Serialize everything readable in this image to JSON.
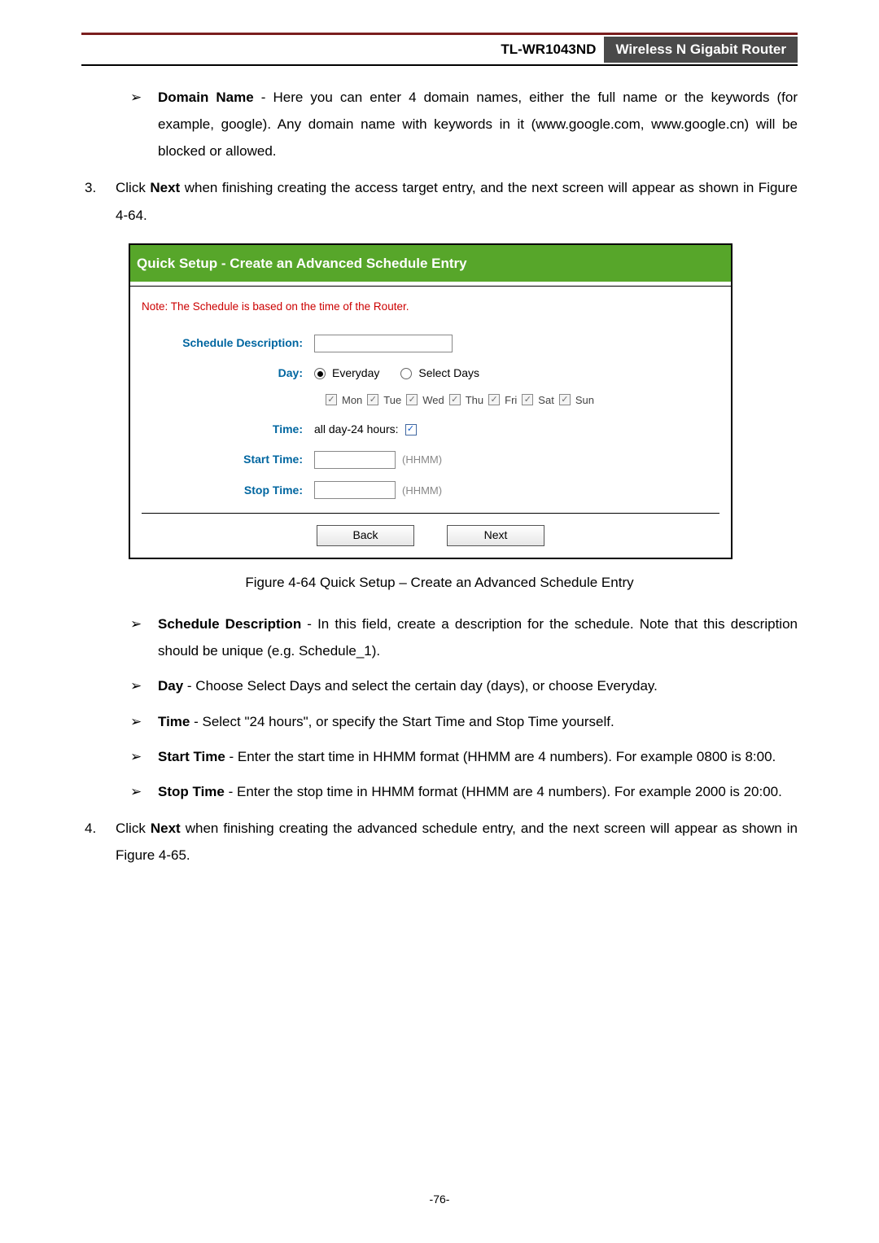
{
  "header": {
    "model": "TL-WR1043ND",
    "product": "Wireless N Gigabit Router"
  },
  "bullets": {
    "domain_name": {
      "label": "Domain Name",
      "text": " - Here you can enter 4 domain names, either the full name or the keywords (for example, google). Any domain name with keywords in it (www.google.com, www.google.cn) will be blocked or allowed."
    },
    "schedule_desc": {
      "label": "Schedule Description",
      "text": " - In this field, create a description for the schedule. Note that this description should be unique (e.g. Schedule_1)."
    },
    "day": {
      "label": "Day",
      "text": " - Choose Select Days and select the certain day (days), or choose Everyday."
    },
    "time": {
      "label": "Time",
      "text": " - Select \"24 hours\", or specify the Start Time and Stop Time yourself."
    },
    "start_time": {
      "label": "Start Time",
      "text": " - Enter the start time in HHMM format (HHMM are 4 numbers). For example 0800 is 8:00."
    },
    "stop_time": {
      "label": "Stop Time",
      "text": " - Enter the stop time in HHMM format (HHMM are 4 numbers). For example 2000 is 20:00."
    }
  },
  "steps": {
    "s3": {
      "num": "3.",
      "pre": "Click ",
      "bold": "Next",
      "post": " when finishing creating the access target entry, and the next screen will appear as shown in Figure 4-64."
    },
    "s4": {
      "num": "4.",
      "pre": "Click ",
      "bold": "Next",
      "post": " when finishing creating the advanced schedule entry, and the next screen will appear as shown in Figure 4-65."
    }
  },
  "figure": {
    "title": "Quick Setup - Create an Advanced Schedule Entry",
    "note": "Note: The Schedule is based on the time of the Router.",
    "labels": {
      "desc": "Schedule Description:",
      "day": "Day:",
      "time": "Time:",
      "start": "Start Time:",
      "stop": "Stop Time:"
    },
    "radios": {
      "everyday": "Everyday",
      "select": "Select Days"
    },
    "days": [
      "Mon",
      "Tue",
      "Wed",
      "Thu",
      "Fri",
      "Sat",
      "Sun"
    ],
    "allday": "all day-24 hours:",
    "hint": "(HHMM)",
    "buttons": {
      "back": "Back",
      "next": "Next"
    },
    "caption": "Figure 4-64    Quick Setup – Create an Advanced Schedule Entry"
  },
  "marks": {
    "arrow": "➢",
    "check": "✓"
  },
  "footer": "-76-"
}
